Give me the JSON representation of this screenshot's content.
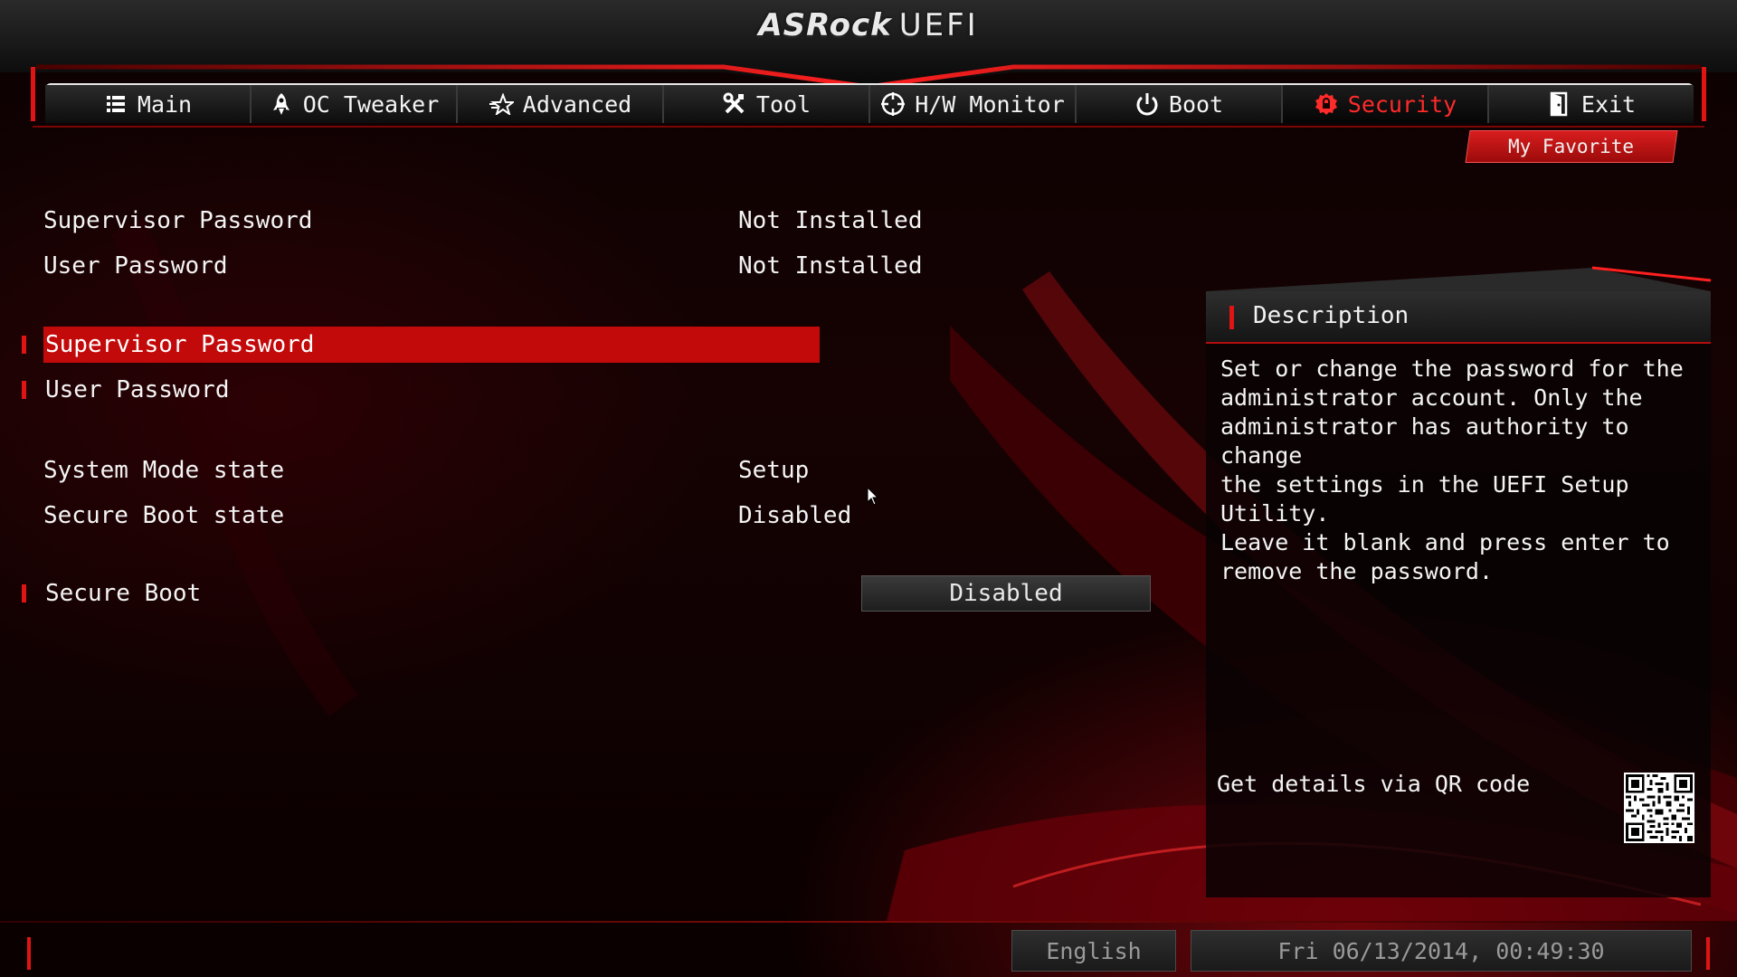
{
  "header": {
    "brand": "ASRock",
    "product": "UEFI"
  },
  "tabs": [
    {
      "label": "Main",
      "icon": "list-icon"
    },
    {
      "label": "OC Tweaker",
      "icon": "rocket-icon"
    },
    {
      "label": "Advanced",
      "icon": "star-icon"
    },
    {
      "label": "Tool",
      "icon": "tools-icon"
    },
    {
      "label": "H/W Monitor",
      "icon": "crosshair-icon"
    },
    {
      "label": "Boot",
      "icon": "power-icon"
    },
    {
      "label": "Security",
      "icon": "shield-icon",
      "active": true
    },
    {
      "label": "Exit",
      "icon": "door-icon"
    }
  ],
  "my_favorite": "My Favorite",
  "status": {
    "supervisor_password": {
      "label": "Supervisor Password",
      "value": "Not Installed"
    },
    "user_password": {
      "label": "User Password",
      "value": "Not Installed"
    },
    "system_mode": {
      "label": "System Mode state",
      "value": "Setup"
    },
    "secure_boot_state": {
      "label": "Secure Boot state",
      "value": "Disabled"
    }
  },
  "items": {
    "supervisor_password": "Supervisor Password",
    "user_password": "User Password",
    "secure_boot": {
      "label": "Secure Boot",
      "value": "Disabled"
    }
  },
  "description": {
    "title": "Description",
    "text": "Set or change the password for the\nadministrator account. Only the\nadministrator has authority to change\nthe settings in the UEFI Setup Utility.\nLeave it blank and press enter to\nremove the password.",
    "qr_label": "Get details via QR code"
  },
  "footer": {
    "language": "English",
    "datetime": "Fri 06/13/2014, 00:49:30"
  },
  "colors": {
    "accent": "#c30a0a",
    "accent_bright": "#ff2a2a",
    "text": "#f4f4f4",
    "muted": "#9a9a9a"
  }
}
